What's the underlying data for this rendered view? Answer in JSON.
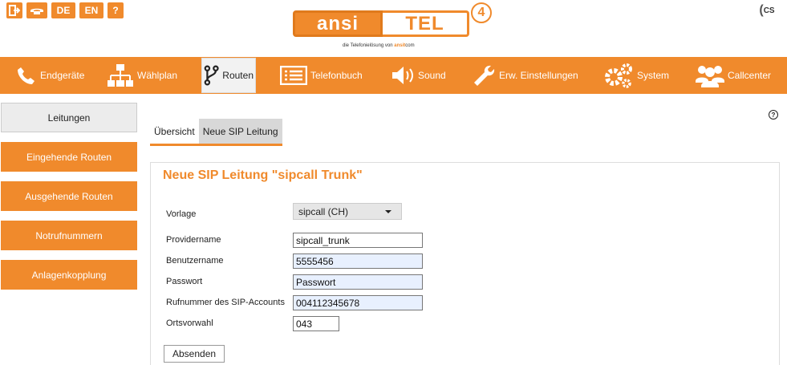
{
  "topbar": {
    "lang_de": "DE",
    "lang_en": "EN",
    "help_glyph": "?",
    "icons": [
      "logout-icon",
      "phone-icon",
      "help-icon"
    ]
  },
  "logo": {
    "left": "ansi",
    "right": "TEL",
    "number": "4",
    "tagline": "die Telefonielösung von",
    "tagline_brand": "ansit",
    "tagline_suffix": "com"
  },
  "cs_badge": "CS",
  "nav": {
    "items": [
      {
        "label": "Endgeräte",
        "icon": "phone-icon"
      },
      {
        "label": "Wählplan",
        "icon": "hierarchy-icon"
      },
      {
        "label": "Routen",
        "icon": "route-icon"
      },
      {
        "label": "Telefonbuch",
        "icon": "phonebook-icon"
      },
      {
        "label": "Sound",
        "icon": "speaker-icon"
      },
      {
        "label": "Erw. Einstellungen",
        "icon": "wrench-icon"
      },
      {
        "label": "System",
        "icon": "gears-icon"
      },
      {
        "label": "Callcenter",
        "icon": "group-icon"
      }
    ],
    "active": "Routen"
  },
  "sidebar": {
    "items": [
      {
        "label": "Leitungen"
      },
      {
        "label": "Eingehende Routen"
      },
      {
        "label": "Ausgehende Routen"
      },
      {
        "label": "Notrufnummern"
      },
      {
        "label": "Anlagenkopplung"
      }
    ],
    "active": "Leitungen"
  },
  "help_glyph": "?",
  "subtabs": [
    {
      "label": "Übersicht"
    },
    {
      "label": "Neue SIP Leitung"
    }
  ],
  "form": {
    "title": "Neue SIP Leitung \"sipcall Trunk\"",
    "vorlage_label": "Vorlage",
    "vorlage_value": "sipcall (CH)",
    "providername_label": "Providername",
    "providername_value": "sipcall_trunk",
    "benutzername_label": "Benutzername",
    "benutzername_value": "5555456",
    "passwort_label": "Passwort",
    "passwort_value": "Passwort",
    "rufnummer_label": "Rufnummer des SIP-Accounts",
    "rufnummer_value": "004112345678",
    "ortsvorwahl_label": "Ortsvorwahl",
    "ortsvorwahl_value": "043",
    "submit_label": "Absenden"
  },
  "colors": {
    "accent": "#f08a2c",
    "autofill": "#e8f0fe"
  }
}
